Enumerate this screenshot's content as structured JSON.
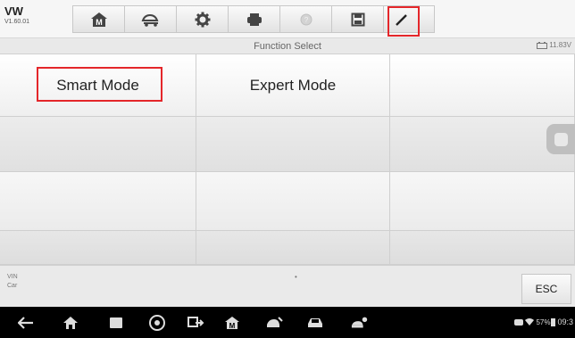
{
  "app": {
    "brand": "VW",
    "version": "V1.60.01"
  },
  "toolbar": {
    "buttons": [
      {
        "icon": "home-m-icon"
      },
      {
        "icon": "vehicle-swap-icon"
      },
      {
        "icon": "gear-icon"
      },
      {
        "icon": "printer-icon"
      },
      {
        "icon": "help-icon"
      },
      {
        "icon": "save-icon"
      },
      {
        "icon": "edit-pen-icon",
        "highlighted": true
      }
    ]
  },
  "subheader": {
    "title": "Function Select",
    "battery": "11.83V"
  },
  "grid": {
    "cells": [
      {
        "label": "Smart Mode",
        "highlighted": true
      },
      {
        "label": "Expert Mode"
      },
      {
        "label": ""
      }
    ]
  },
  "footer": {
    "vin_label": "VIN",
    "car_label": "Car",
    "marker": "•",
    "esc_label": "ESC"
  },
  "statusbar": {
    "battery_pct": "57%",
    "clock": "09:3"
  },
  "colors": {
    "highlight": "#e4262a",
    "navbar": "#000000"
  }
}
